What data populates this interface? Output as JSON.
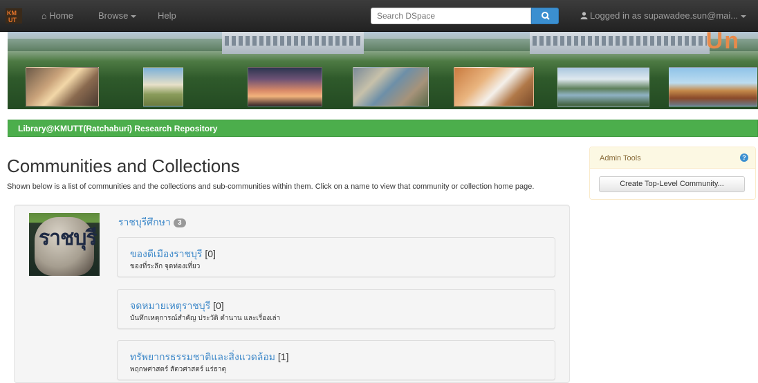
{
  "navbar": {
    "home_label": "Home",
    "browse_label": "Browse",
    "help_label": "Help",
    "search_placeholder": "Search DSpace",
    "user_label": "Logged in as supawadee.sun@mai..."
  },
  "banner": {
    "logo_text": "Un"
  },
  "repository_bar": {
    "title": "Library@KMUTT(Ratchaburi) Research Repository"
  },
  "main": {
    "title": "Communities and Collections",
    "intro": "Shown below is a list of communities and the collections and sub-communities within them. Click on a name to view that community or collection home page."
  },
  "community": {
    "name": "ราชบุรีศึกษา",
    "count": "3",
    "logo_text": "ราชบุรี",
    "collections": [
      {
        "name": "ของดีเมืองราชบุรี",
        "count": "[0]",
        "description": "ของที่ระลึก จุดท่องเที่ยว"
      },
      {
        "name": "จดหมายเหตุราชบุรี",
        "count": "[0]",
        "description": "บันทึกเหตุการณ์สำคัญ ประวัติ ตำนาน และเรื่องเล่า"
      },
      {
        "name": "ทรัพยากรธรรมชาติและสิ่งแวดล้อม",
        "count": "[1]",
        "description": "พฤกษศาสตร์ สัตวศาสตร์ แร่ธาตุ"
      }
    ]
  },
  "admin_tools": {
    "title": "Admin Tools",
    "help_glyph": "?",
    "create_button": "Create Top-Level Community..."
  },
  "colors": {
    "navbar": "#222222",
    "green_bar": "#4cae4c",
    "link": "#428bca",
    "search_button": "#3b8fd0",
    "admin_header": "#fcf8e3"
  }
}
